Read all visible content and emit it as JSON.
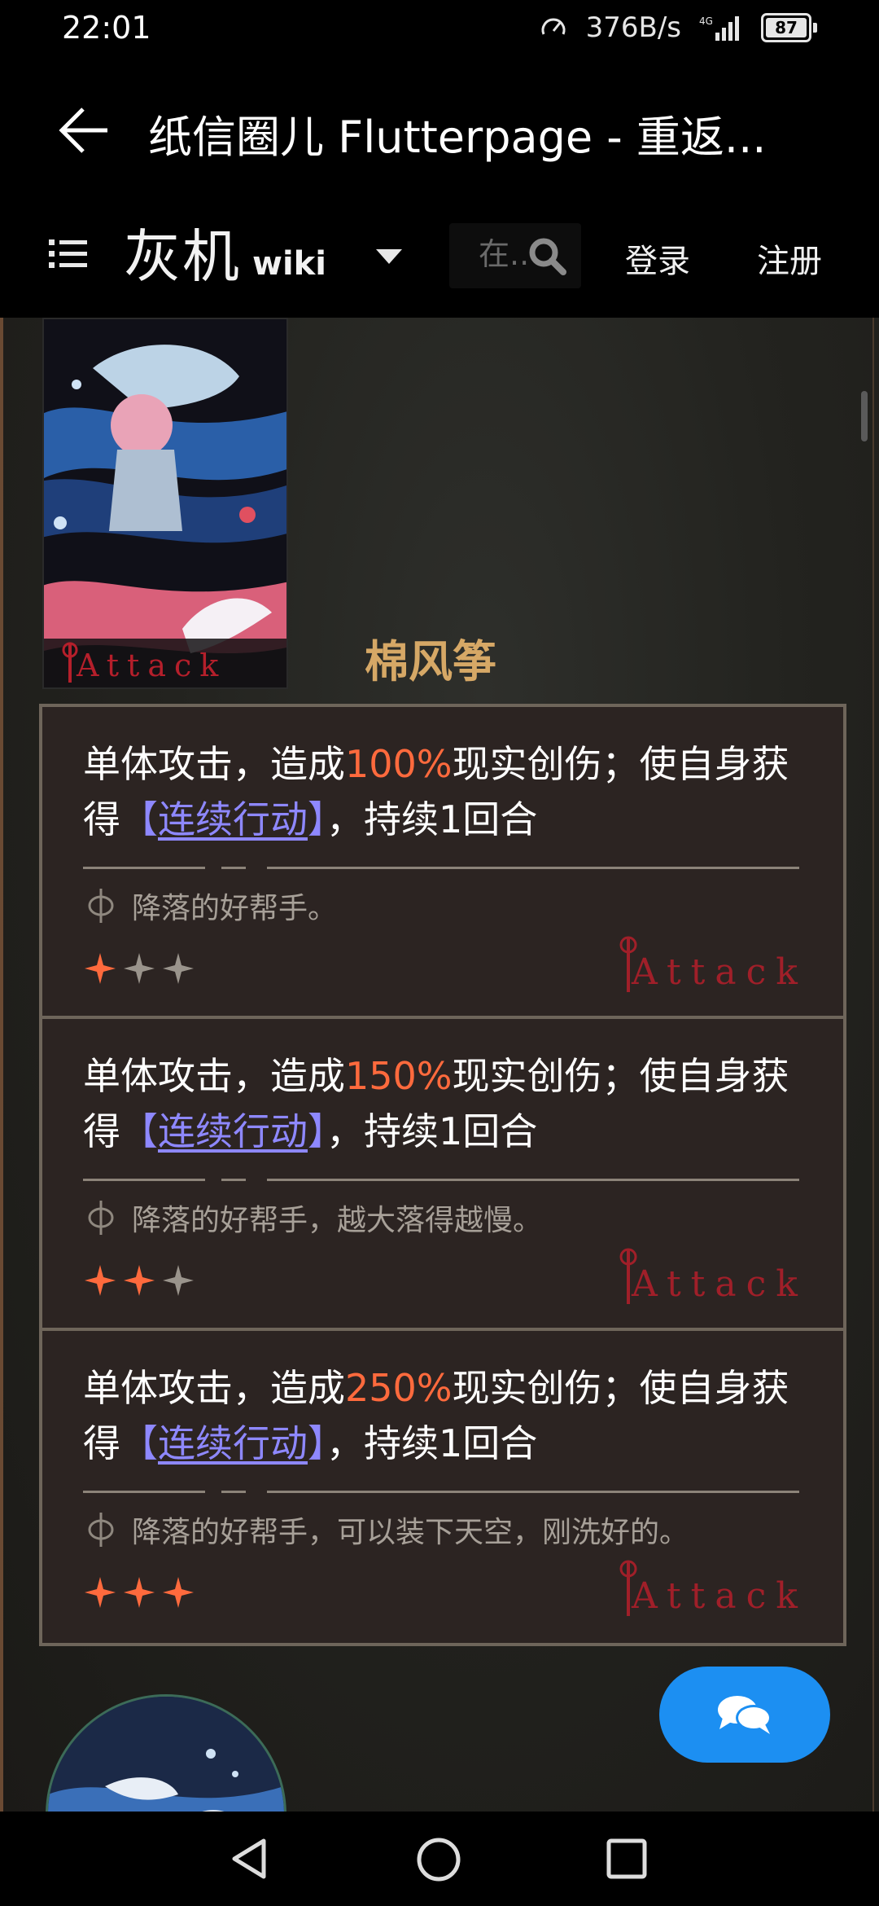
{
  "status_bar": {
    "time": "22:01",
    "net_speed": "376B/s",
    "signal_label": "4G",
    "battery": "87"
  },
  "app_bar": {
    "title": "纸信圈儿 Flutterpage - 重返..."
  },
  "wiki_header": {
    "logo_cn": "灰机",
    "logo_en": "wiki",
    "search_placeholder": "在...",
    "login": "登录",
    "register": "注册"
  },
  "character": {
    "name": "棉风筝"
  },
  "skills": [
    {
      "prefix": "单体攻击，造成",
      "percent": "100%",
      "suffix": "现实创伤；使自身获得",
      "link": "连续行动",
      "bracket_open": "【",
      "bracket_close": "】",
      "tail": "，持续1回合",
      "flavor": "降落的好帮手。",
      "stars": 1,
      "stamp": "Attack"
    },
    {
      "prefix": "单体攻击，造成",
      "percent": "150%",
      "suffix": "现实创伤；使自身获得",
      "link": "连续行动",
      "bracket_open": "【",
      "bracket_close": "】",
      "tail": "，持续1回合",
      "flavor": "降落的好帮手，越大落得越慢。",
      "stars": 2,
      "stamp": "Attack"
    },
    {
      "prefix": "单体攻击，造成",
      "percent": "250%",
      "suffix": "现实创伤；使自身获得",
      "link": "连续行动",
      "bracket_open": "【",
      "bracket_close": "】",
      "tail": "，持续1回合",
      "flavor": "降落的好帮手，可以装下天空，刚洗好的。",
      "stars": 3,
      "stamp": "Attack"
    }
  ],
  "card_tag": "Attack",
  "colors": {
    "accent_orange": "#ff6a3d",
    "link_purple": "#8e88ff",
    "name_gold": "#d6a866",
    "fab_blue": "#1c8ff2",
    "stamp_red": "#b51f2b"
  },
  "icons": {
    "back": "arrow-left-icon",
    "menu": "list-icon",
    "search": "search-icon",
    "caret": "caret-down-icon",
    "fab": "comments-icon",
    "nav": [
      "back-triangle-icon",
      "home-circle-icon",
      "recents-square-icon"
    ]
  }
}
